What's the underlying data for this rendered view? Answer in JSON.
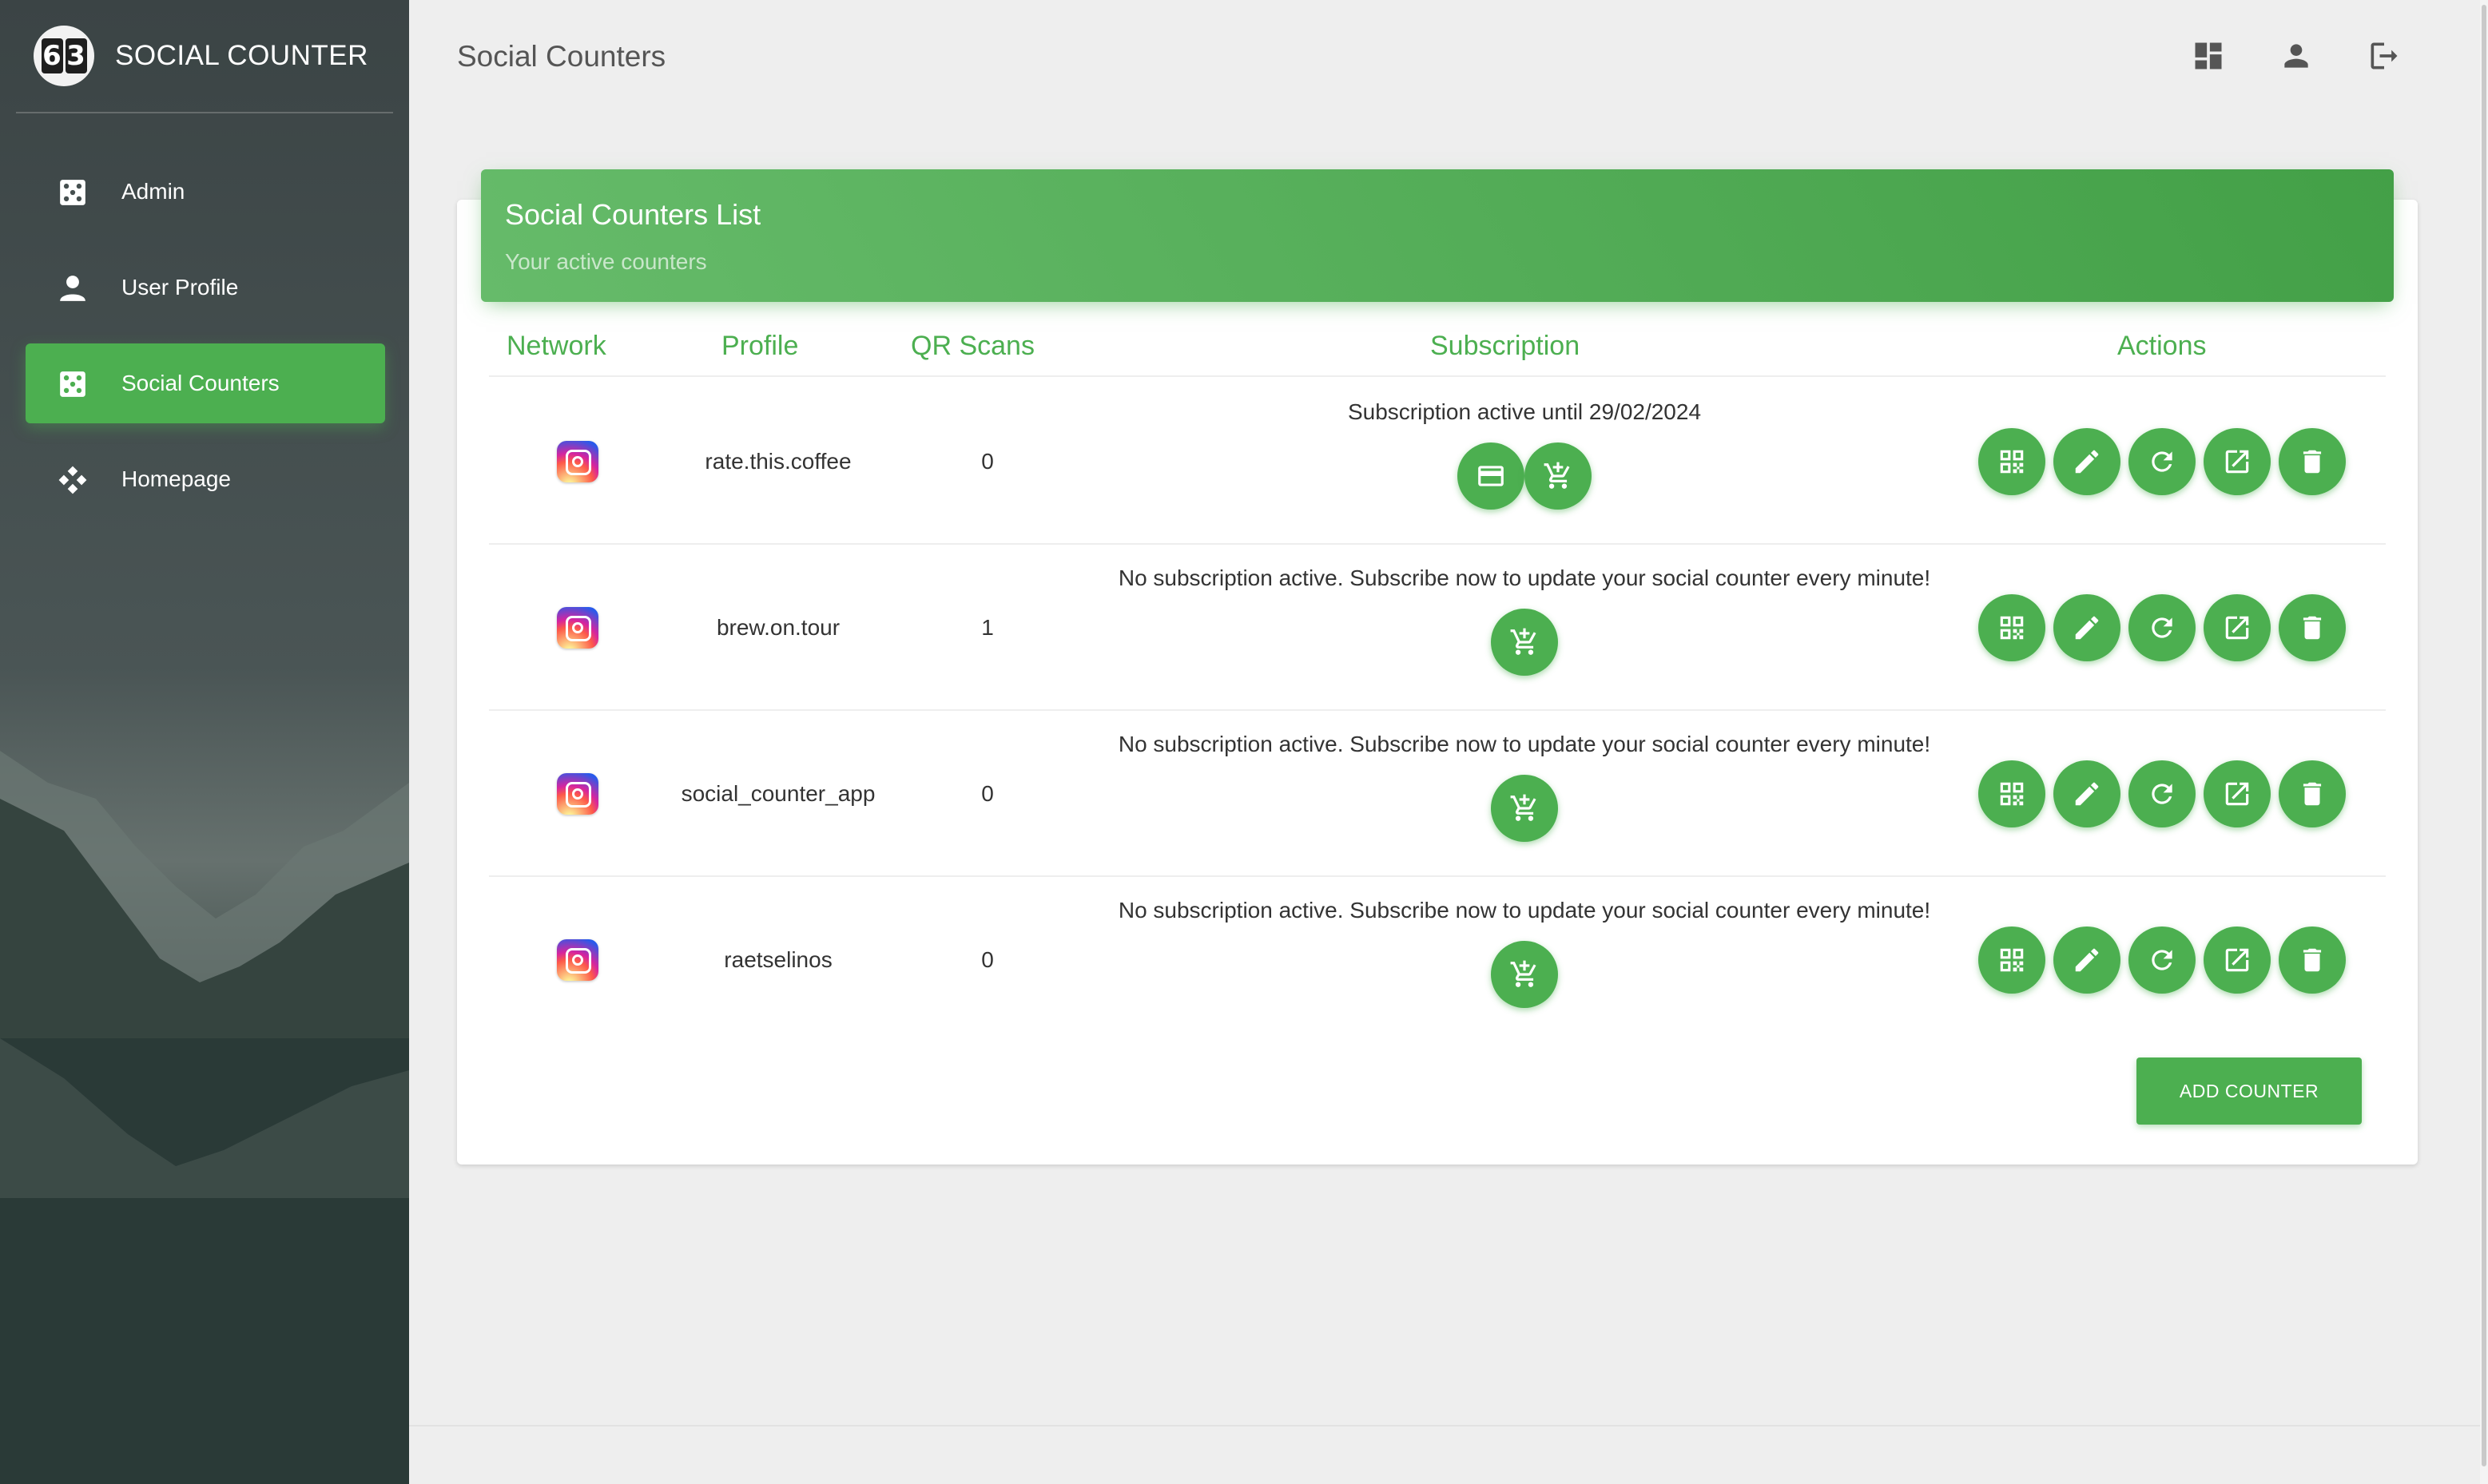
{
  "brand": {
    "name": "SOCIAL COUNTER",
    "logo_digits": [
      "6",
      "3"
    ]
  },
  "sidebar": {
    "items": [
      {
        "label": "Admin",
        "icon": "dashboard-dice-icon",
        "active": false
      },
      {
        "label": "User Profile",
        "icon": "person-icon",
        "active": false
      },
      {
        "label": "Social Counters",
        "icon": "dashboard-dice-icon",
        "active": true
      },
      {
        "label": "Homepage",
        "icon": "apps-diamond-icon",
        "active": false
      }
    ]
  },
  "header": {
    "title": "Social Counters",
    "icons": [
      "dashboard-icon",
      "person-icon",
      "logout-icon"
    ]
  },
  "card": {
    "title": "Social Counters List",
    "subtitle": "Your active counters",
    "columns": [
      "Network",
      "Profile",
      "QR Scans",
      "Subscription",
      "Actions"
    ]
  },
  "rows": [
    {
      "network": "instagram-icon",
      "profile": "rate.this.coffee",
      "qr_scans": "0",
      "subscription": "Subscription active until 29/02/2024",
      "sub_buttons": [
        "credit-card-icon",
        "add-shopping-cart-icon"
      ]
    },
    {
      "network": "instagram-icon",
      "profile": "brew.on.tour",
      "qr_scans": "1",
      "subscription": "No subscription active. Subscribe now to update your social counter every minute!",
      "sub_buttons": [
        "add-shopping-cart-icon"
      ]
    },
    {
      "network": "instagram-icon",
      "profile": "social_counter_app",
      "qr_scans": "0",
      "subscription": "No subscription active. Subscribe now to update your social counter every minute!",
      "sub_buttons": [
        "add-shopping-cart-icon"
      ]
    },
    {
      "network": "instagram-icon",
      "profile": "raetselinos",
      "qr_scans": "0",
      "subscription": "No subscription active. Subscribe now to update your social counter every minute!",
      "sub_buttons": [
        "add-shopping-cart-icon"
      ]
    }
  ],
  "row_actions": [
    "qr-code-icon",
    "edit-pencil-icon",
    "refresh-icon",
    "open-external-icon",
    "delete-trash-icon"
  ],
  "add_button": {
    "label": "ADD COUNTER"
  },
  "colors": {
    "accent": "#4caf50",
    "sidebar_bg": "#3f494a"
  }
}
